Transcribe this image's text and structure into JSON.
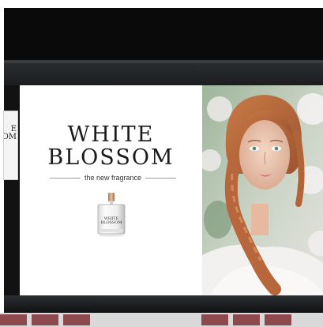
{
  "campaign": {
    "title_line1": "WHITE",
    "title_line2": "BLOSSOM",
    "tagline": "the new fragrance",
    "bottle_label_line1": "WHITE",
    "bottle_label_line2": "BLOSSOM"
  },
  "side_sign": {
    "line1": "E",
    "line2": "OM"
  },
  "colors": {
    "facade": "#121212",
    "tagline_rule": "#7ea79d",
    "hair": "#b8673c",
    "pavement_tile": "#8c4a4f"
  }
}
